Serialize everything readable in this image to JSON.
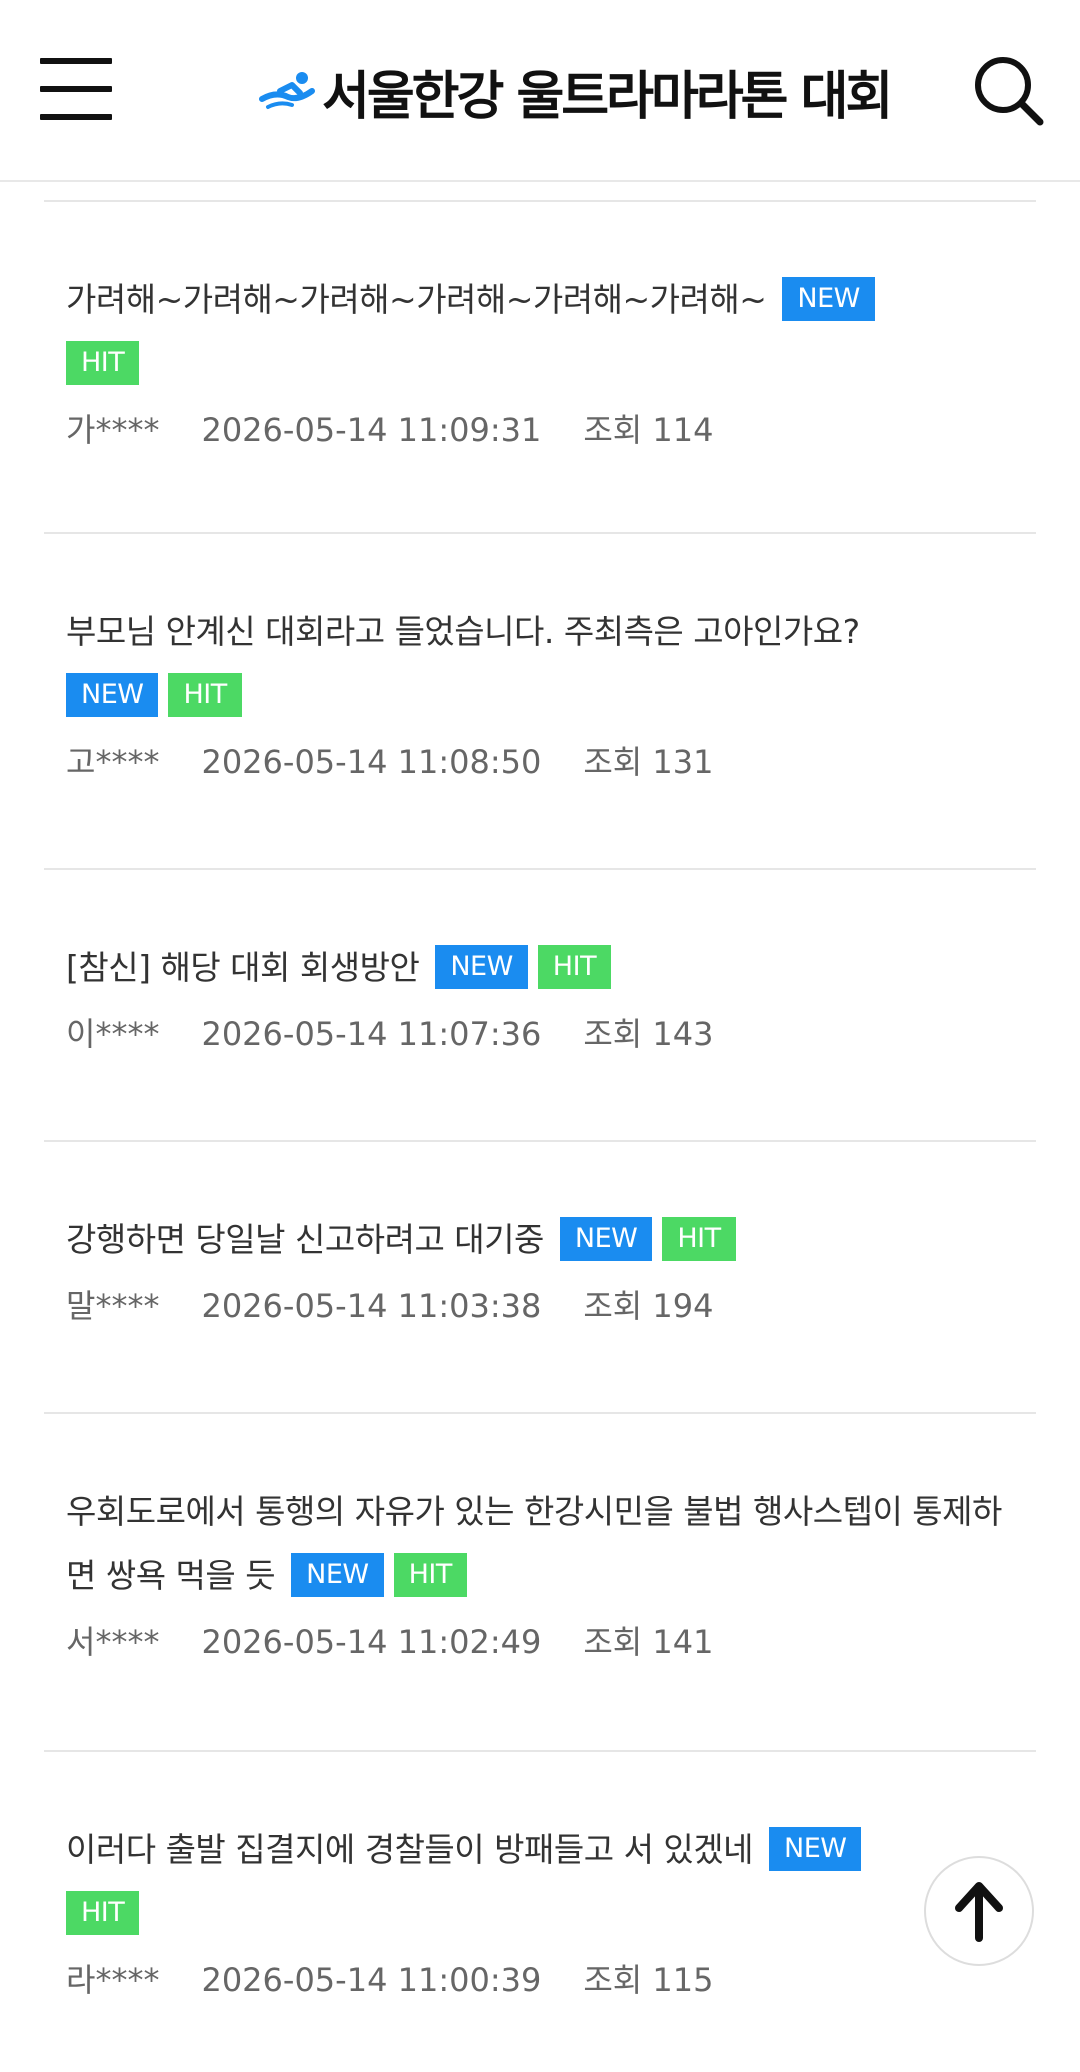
{
  "header": {
    "title": "서울한강 울트라마라톤 대회",
    "menu_icon": "hamburger-menu-icon",
    "search_icon": "search-icon",
    "accent_color": "#1a8cf0"
  },
  "posts": [
    {
      "title": "가려해~가려해~가려해~가려해~가려해~가려해~",
      "badges": [
        "NEW",
        "HIT"
      ],
      "author": "가****",
      "date": "2026-05-14 11:09:31",
      "views": "조회 114"
    },
    {
      "title": "부모님 안계신 대회라고 들었습니다. 주최측은 고아인가요?",
      "badges": [
        "NEW",
        "HIT"
      ],
      "author": "고****",
      "date": "2026-05-14 11:08:50",
      "views": "조회 131"
    },
    {
      "title": "[참신] 해당 대회 회생방안",
      "badges": [
        "NEW",
        "HIT"
      ],
      "author": "이****",
      "date": "2026-05-14 11:07:36",
      "views": "조회 143"
    },
    {
      "title": "강행하면 당일날 신고하려고 대기중",
      "badges": [
        "NEW",
        "HIT"
      ],
      "author": "말****",
      "date": "2026-05-14 11:03:38",
      "views": "조회 194"
    },
    {
      "title": "우회도로에서 통행의 자유가 있는 한강시민을 불법 행사스텝이 통제하면 쌍욕 먹을 듯",
      "badges": [
        "NEW",
        "HIT"
      ],
      "author": "서****",
      "date": "2026-05-14 11:02:49",
      "views": "조회 141"
    },
    {
      "title": "이러다 출발 집결지에 경찰들이 방패들고 서 있겠네",
      "badges": [
        "NEW",
        "HIT"
      ],
      "author": "라****",
      "date": "2026-05-14 11:00:39",
      "views": "조회 115"
    }
  ],
  "badge_colors": {
    "NEW": "#1a8cf0",
    "HIT": "#4cd964"
  },
  "scroll_top_icon": "arrow-up-icon"
}
